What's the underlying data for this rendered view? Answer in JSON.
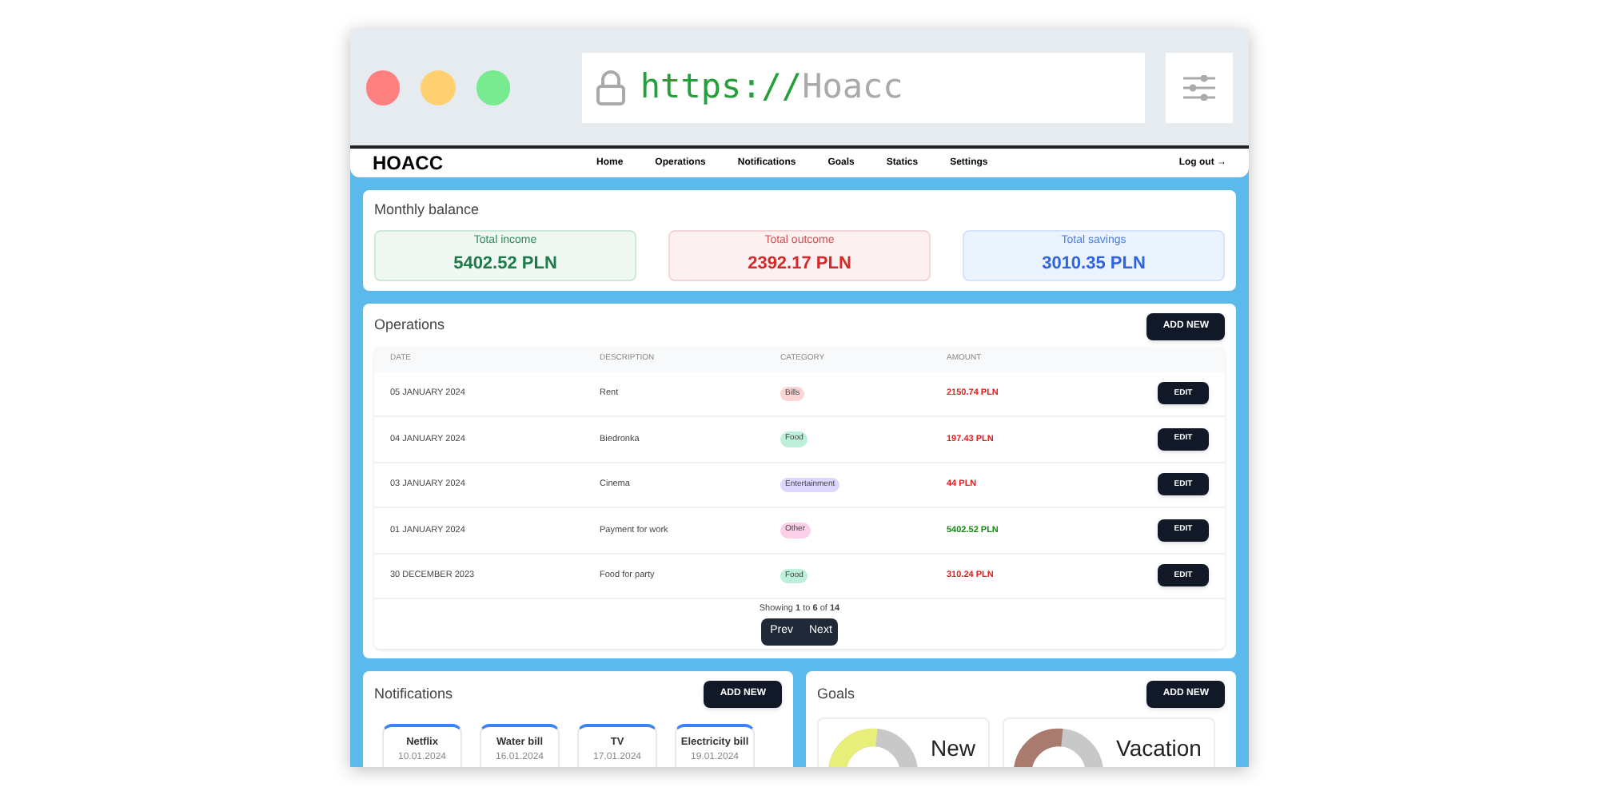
{
  "browser": {
    "scheme": "https://",
    "address": "Hoacc"
  },
  "nav": {
    "logo": "HOACC",
    "links": [
      "Home",
      "Operations",
      "Notifications",
      "Goals",
      "Statics",
      "Settings"
    ],
    "logout": "Log out →"
  },
  "balance": {
    "title": "Monthly balance",
    "tiles": [
      {
        "kind": "income",
        "label": "Total income",
        "value": "5402.52 PLN"
      },
      {
        "kind": "outcome",
        "label": "Total outcome",
        "value": "2392.17 PLN"
      },
      {
        "kind": "savings",
        "label": "Total savings",
        "value": "3010.35 PLN"
      }
    ]
  },
  "operations": {
    "title": "Operations",
    "add_button": "ADD NEW",
    "columns": [
      "DATE",
      "DESCRIPTION",
      "CATEGORY",
      "AMOUNT"
    ],
    "rows": [
      {
        "date": "05 JANUARY 2024",
        "description": "Rent",
        "category": "Bills",
        "color": "#fbd5d5",
        "amount": "2150.74 PLN",
        "kind": "expense",
        "action": "EDIT"
      },
      {
        "date": "04 JANUARY 2024",
        "description": "Biedronka",
        "category": "Food",
        "color": "#bcf0da",
        "amount": "197.43 PLN",
        "kind": "expense",
        "action": "EDIT"
      },
      {
        "date": "03 JANUARY 2024",
        "description": "Cinema",
        "category": "Entertainment",
        "color": "#ddd6fe",
        "amount": "44 PLN",
        "kind": "expense",
        "action": "EDIT"
      },
      {
        "date": "01 JANUARY 2024",
        "description": "Payment for work",
        "category": "Other",
        "color": "#fbcfe8",
        "amount": "5402.52 PLN",
        "kind": "income",
        "action": "EDIT"
      },
      {
        "date": "30 DECEMBER 2023",
        "description": "Food for party",
        "category": "Food",
        "color": "#bcf0da",
        "amount": "310.24 PLN",
        "kind": "expense",
        "action": "EDIT"
      }
    ],
    "showing": "Showing **1** to **6** of **14**",
    "prev": "Prev",
    "next": "Next"
  },
  "notifications": {
    "title": "Notifications",
    "add_button": "ADD NEW",
    "items": [
      {
        "name": "Netflix",
        "date": "10.01.2024"
      },
      {
        "name": "Water bill",
        "date": "16.01.2024"
      },
      {
        "name": "TV",
        "date": "17.01.2024"
      },
      {
        "name": "Electricity bill",
        "date": "19.01.2024"
      }
    ]
  },
  "goals": {
    "title": "Goals",
    "add_button": "ADD NEW",
    "items": [
      {
        "name": "New",
        "color": "#e8ee7a"
      },
      {
        "name": "Vacation",
        "color": "#a97a6e"
      }
    ]
  }
}
